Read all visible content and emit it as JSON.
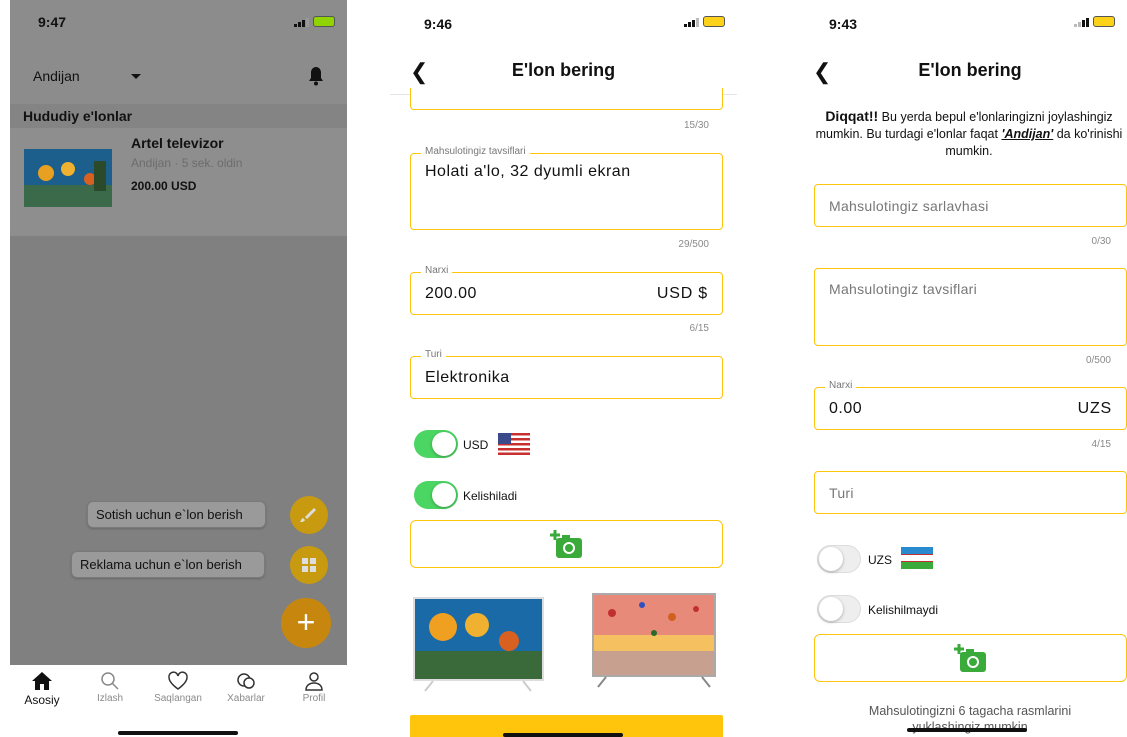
{
  "screen1": {
    "status_time": "9:47",
    "location": "Andijan",
    "section_title": "Hududiy e'lonlar",
    "listing": {
      "title": "Artel televizor",
      "meta": "Andijan · 5 sek. oldin",
      "price": "200.00 USD"
    },
    "actions": [
      {
        "label": "Sotish uchun e`lon berish",
        "icon": "brush-icon"
      },
      {
        "label": "Reklama uchun e`lon berish",
        "icon": "grid-icon"
      }
    ],
    "fab_icon": "plus-icon",
    "tabs": [
      {
        "label": "Asosiy",
        "icon": "home-icon",
        "active": true
      },
      {
        "label": "Izlash",
        "icon": "search-icon",
        "active": false
      },
      {
        "label": "Saqlangan",
        "icon": "heart-icon",
        "active": false
      },
      {
        "label": "Xabarlar",
        "icon": "chat-icon",
        "active": false
      },
      {
        "label": "Profil",
        "icon": "user-icon",
        "active": false
      }
    ]
  },
  "screen2": {
    "status_time": "9:46",
    "title": "E'lon bering",
    "title_counter": "15/30",
    "description": {
      "label": "Mahsulotingiz tavsiflari",
      "value": "Holati a'lo, 32 dyumli ekran",
      "counter": "29/500"
    },
    "price": {
      "label": "Narxi",
      "value": "200.00",
      "currency": "USD $",
      "counter": "6/15"
    },
    "type": {
      "label": "Turi",
      "value": "Elektronika"
    },
    "currency_toggle": {
      "label": "USD",
      "on": true
    },
    "negotiable_toggle": {
      "label": "Kelishiladi",
      "on": true
    }
  },
  "screen3": {
    "status_time": "9:43",
    "title": "E'lon bering",
    "notice_bold": "Diqqat!!",
    "notice_text1": " Bu yerda bepul e'lonlaringizni joylashingiz mumkin. Bu turdagi e'lonlar faqat ",
    "notice_region": "'Andijan'",
    "notice_text2": " da ko'rinishi mumkin.",
    "title_field": {
      "placeholder": "Mahsulotingiz sarlavhasi",
      "counter": "0/30"
    },
    "description": {
      "placeholder": "Mahsulotingiz tavsiflari",
      "counter": "0/500"
    },
    "price": {
      "label": "Narxi",
      "value": "0.00",
      "currency": "UZS",
      "counter": "4/15"
    },
    "type": {
      "placeholder": "Turi"
    },
    "currency_toggle": {
      "label": "UZS",
      "on": false
    },
    "negotiable_toggle": {
      "label": "Kelishilmaydi",
      "on": false
    },
    "footer_note": "Mahsulotingizni 6 tagacha rasmlarini yuklashingiz mumkin"
  },
  "colors": {
    "accent": "#ffc40c",
    "toggle_on": "#4bd562"
  }
}
